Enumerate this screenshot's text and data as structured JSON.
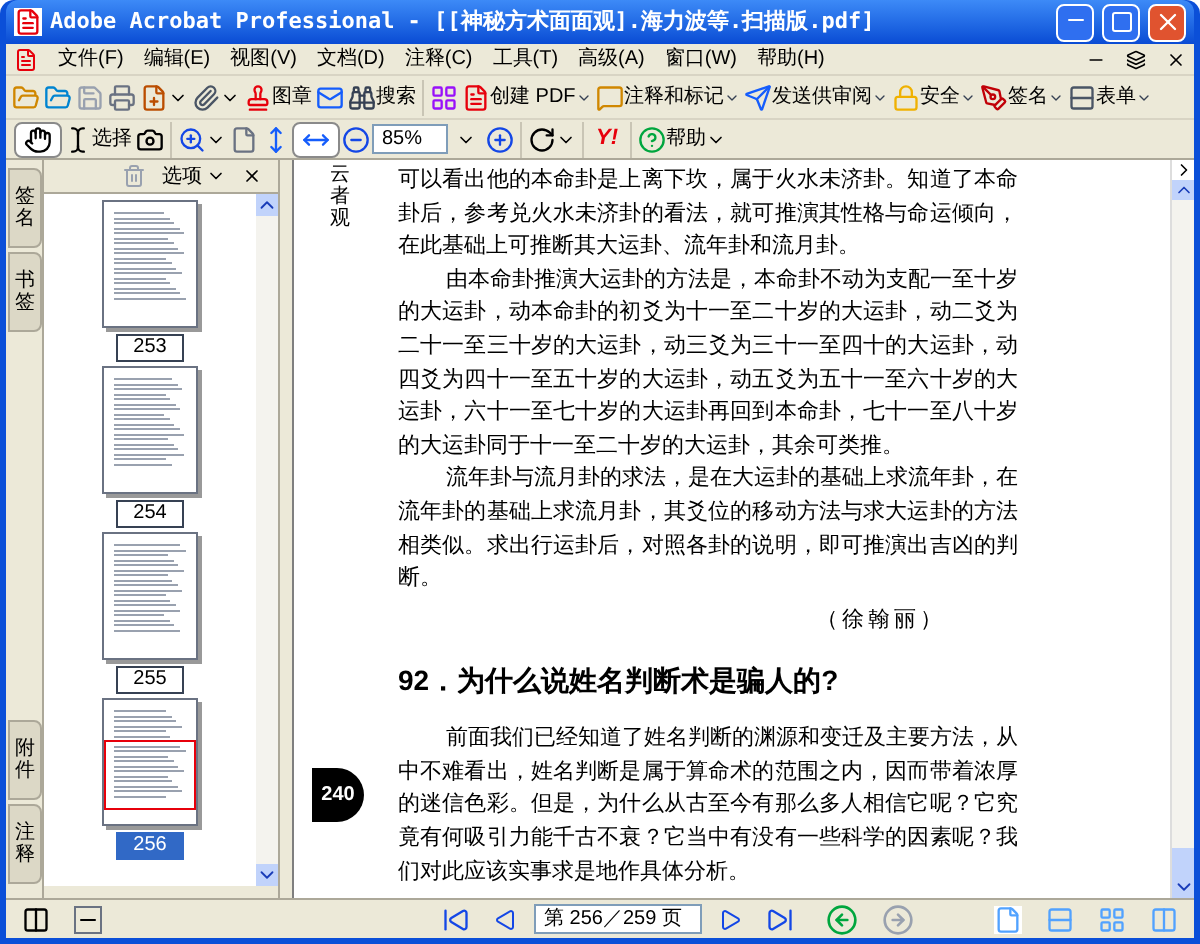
{
  "window": {
    "title": "Adobe Acrobat Professional - [[神秘方术面面观].海力波等.扫描版.pdf]"
  },
  "menu": [
    "文件(F)",
    "编辑(E)",
    "视图(V)",
    "文档(D)",
    "注释(C)",
    "工具(T)",
    "高级(A)",
    "窗口(W)",
    "帮助(H)"
  ],
  "toolbar1": [
    {
      "label": "图章",
      "dropdown": false
    },
    {
      "label": "搜索",
      "dropdown": false
    },
    {
      "label": "创建 PDF",
      "dropdown": true
    },
    {
      "label": "注释和标记",
      "dropdown": true
    },
    {
      "label": "发送供审阅",
      "dropdown": true
    },
    {
      "label": "安全",
      "dropdown": true
    },
    {
      "label": "签名",
      "dropdown": true
    },
    {
      "label": "表单",
      "dropdown": true
    }
  ],
  "toolbar2": {
    "select_label": "选择",
    "zoom_value": "85%",
    "logo_text": "Y!",
    "help_label": "帮助"
  },
  "side_tabs": [
    {
      "label": "签名",
      "selected": false
    },
    {
      "label": "书签",
      "selected": false
    },
    {
      "label": "附件",
      "selected": false
    },
    {
      "label": "注释",
      "selected": false
    }
  ],
  "thumbnails_panel": {
    "options_label": "选项",
    "pages": [
      {
        "label": "253",
        "selected": false
      },
      {
        "label": "254",
        "selected": false
      },
      {
        "label": "255",
        "selected": false
      },
      {
        "label": "256",
        "selected": true
      }
    ]
  },
  "page": {
    "margin_text": "云者观",
    "page_number": "240",
    "paragraphs": [
      {
        "text": "可以看出他的本命卦是上离下坎，属于火水未济卦。知道了本命卦后，参考兑火水未济卦的看法，就可推演其性格与命运倾向，在此基础上可推断其大运卦、流年卦和流月卦。",
        "indent": false
      },
      {
        "text": "由本命卦推演大运卦的方法是，本命卦不动为支配一至十岁的大运卦，动本命卦的初爻为十一至二十岁的大运卦，动二爻为二十一至三十岁的大运卦，动三爻为三十一至四十的大运卦，动四爻为四十一至五十岁的大运卦，动五爻为五十一至六十岁的大运卦，六十一至七十岁的大运卦再回到本命卦，七十一至八十岁的大运卦同于十一至二十岁的大运卦，其余可类推。",
        "indent": true
      },
      {
        "text": "流年卦与流月卦的求法，是在大运卦的基础上求流年卦，在流年卦的基础上求流月卦，其爻位的移动方法与求大运卦的方法相类似。求出行运卦后，对照各卦的说明，即可推演出吉凶的判断。",
        "indent": true
      }
    ],
    "author": "（徐翰丽）",
    "heading": "92．为什么说姓名判断术是骗人的?",
    "paragraphs2": [
      {
        "text": "前面我们已经知道了姓名判断的渊源和变迁及主要方法，从中不难看出，姓名判断是属于算命术的范围之内，因而带着浓厚的迷信色彩。但是，为什么从古至今有那么多人相信它呢？它究竟有何吸引力能千古不衰？它当中有没有一些科学的因素呢？我们对此应该实事求是地作具体分析。",
        "indent": true
      }
    ]
  },
  "status_bar": {
    "page_field": "第 256／259 页"
  }
}
